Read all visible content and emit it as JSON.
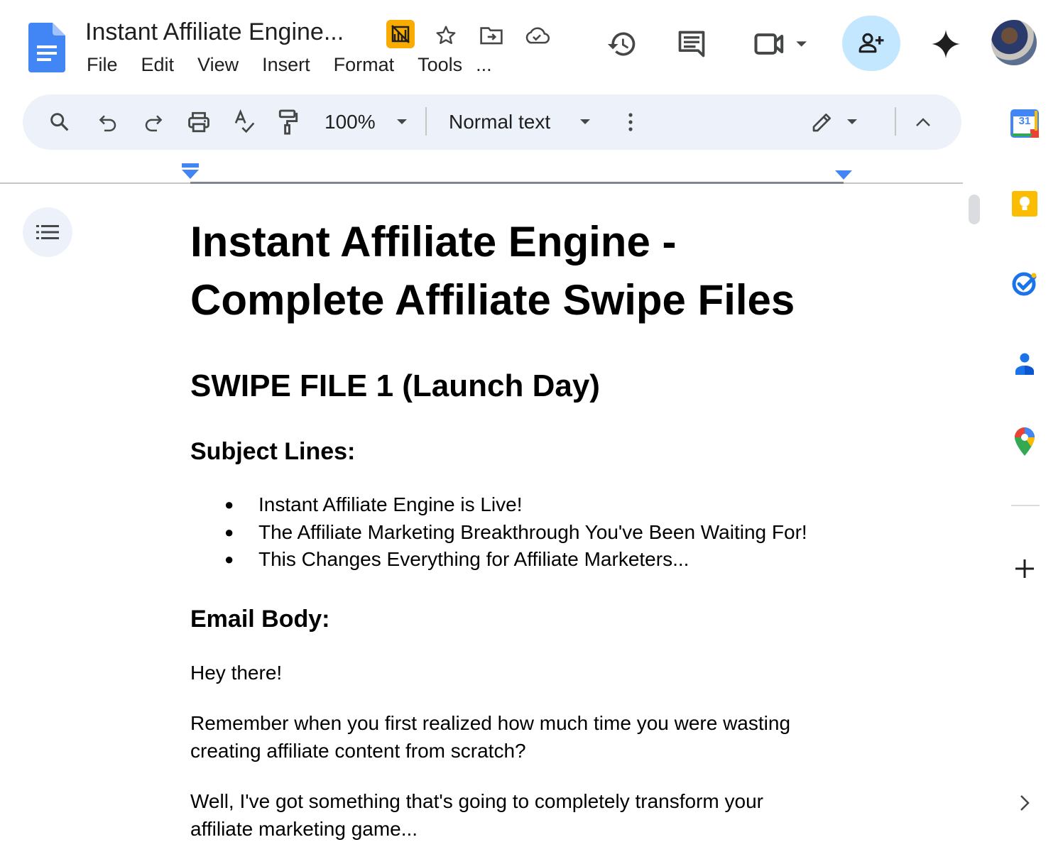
{
  "header": {
    "title": "Instant Affiliate Engine...",
    "menu": [
      "File",
      "Edit",
      "View",
      "Insert",
      "Format",
      "Tools",
      "..."
    ]
  },
  "toolbar": {
    "zoom": "100%",
    "style": "Normal text"
  },
  "document": {
    "title_line1": "Instant Affiliate Engine -",
    "title_line2": "Complete Affiliate Swipe Files",
    "section_heading": "SWIPE FILE 1 (Launch Day)",
    "subject_heading": "Subject Lines:",
    "subject_lines": [
      "Instant Affiliate Engine is Live!",
      "The Affiliate Marketing Breakthrough You've Been Waiting For!",
      "This Changes Everything for Affiliate Marketers..."
    ],
    "body_heading": "Email Body:",
    "paragraphs": [
      "Hey there!",
      "Remember when you first realized how much time you were wasting creating affiliate content from scratch?",
      "Well, I've got something that's going to completely transform your affiliate marketing game..."
    ]
  },
  "side_panel": {
    "calendar_day": "31",
    "icons": [
      "calendar-icon",
      "keep-icon",
      "tasks-icon",
      "contacts-icon",
      "maps-icon",
      "add-icon",
      "expand-icon"
    ]
  },
  "colors": {
    "docs_blue": "#4285f4",
    "toolbar_bg": "#edf2fa",
    "share_bg": "#c2e7ff",
    "badge": "#f9ab00"
  }
}
